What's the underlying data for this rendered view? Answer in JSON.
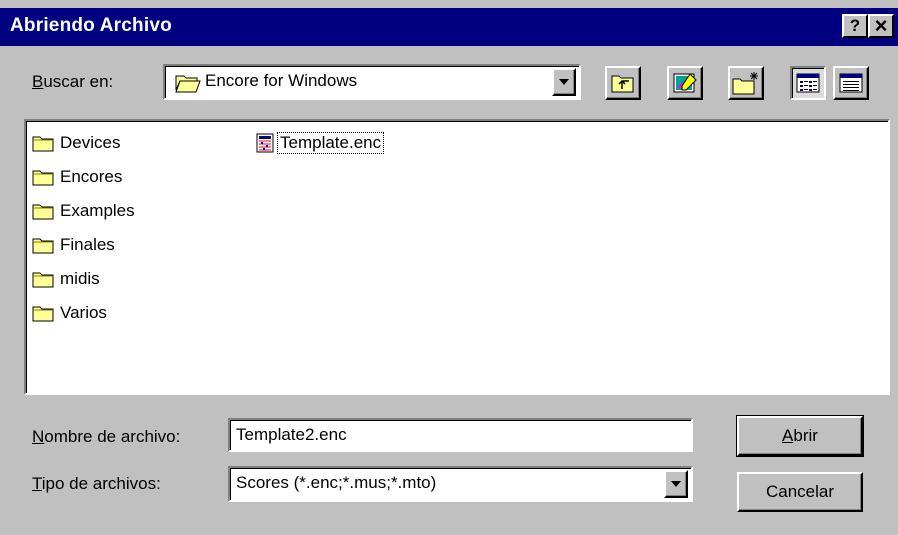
{
  "window": {
    "title": "Abriendo Archivo",
    "help_label": "?",
    "close_label": "×"
  },
  "lookin": {
    "label_prefix": "",
    "label_key": "B",
    "label_rest": "uscar en:",
    "value": "Encore for Windows"
  },
  "toolbar": {
    "icons": [
      "folder-up-icon",
      "desktop-icon",
      "new-folder-icon",
      "list-view-icon",
      "details-view-icon"
    ]
  },
  "files": {
    "folders": [
      "Devices",
      "Encores",
      "Examples",
      "Finales",
      "midis",
      "Varios"
    ],
    "documents": [
      "Template.enc"
    ]
  },
  "filename": {
    "label_key": "N",
    "label_rest": "ombre de archivo:",
    "value": "Template2.enc"
  },
  "filetype": {
    "label_key": "T",
    "label_rest": "ipo de archivos:",
    "value": "Scores (*.enc;*.mus;*.mto)"
  },
  "buttons": {
    "open_key": "A",
    "open_rest": "brir",
    "cancel": "Cancelar"
  },
  "colors": {
    "titlebar": "#000080",
    "face": "#c0c0c0",
    "folder": "#ffff99"
  }
}
